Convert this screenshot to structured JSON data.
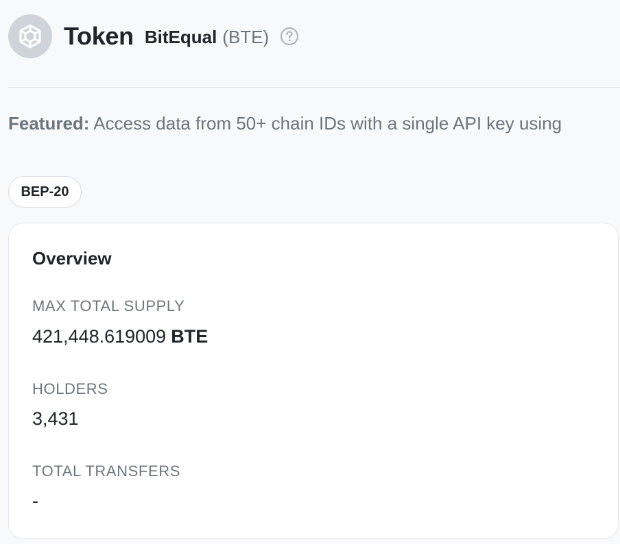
{
  "header": {
    "title": "Token",
    "token_name": "BitEqual",
    "token_symbol": "(BTE)",
    "logo_icon": "bnb-chain-logo-icon",
    "help_icon": "question-circle-icon"
  },
  "featured": {
    "label": "Featured:",
    "text": "Access data from 50+ chain IDs with a single API key using"
  },
  "badge": {
    "label": "BEP-20"
  },
  "overview": {
    "title": "Overview",
    "max_total_supply_label": "MAX TOTAL SUPPLY",
    "max_total_supply_value": "421,448.619009",
    "max_total_supply_unit": "BTE",
    "holders_label": "HOLDERS",
    "holders_value": "3,431",
    "total_transfers_label": "TOTAL TRANSFERS",
    "total_transfers_value": "-"
  },
  "colors": {
    "page_background": "#f8f9fa",
    "card_background": "#ffffff",
    "text_primary": "#212529",
    "text_muted": "#6c757d",
    "border": "#e3e6ea"
  }
}
